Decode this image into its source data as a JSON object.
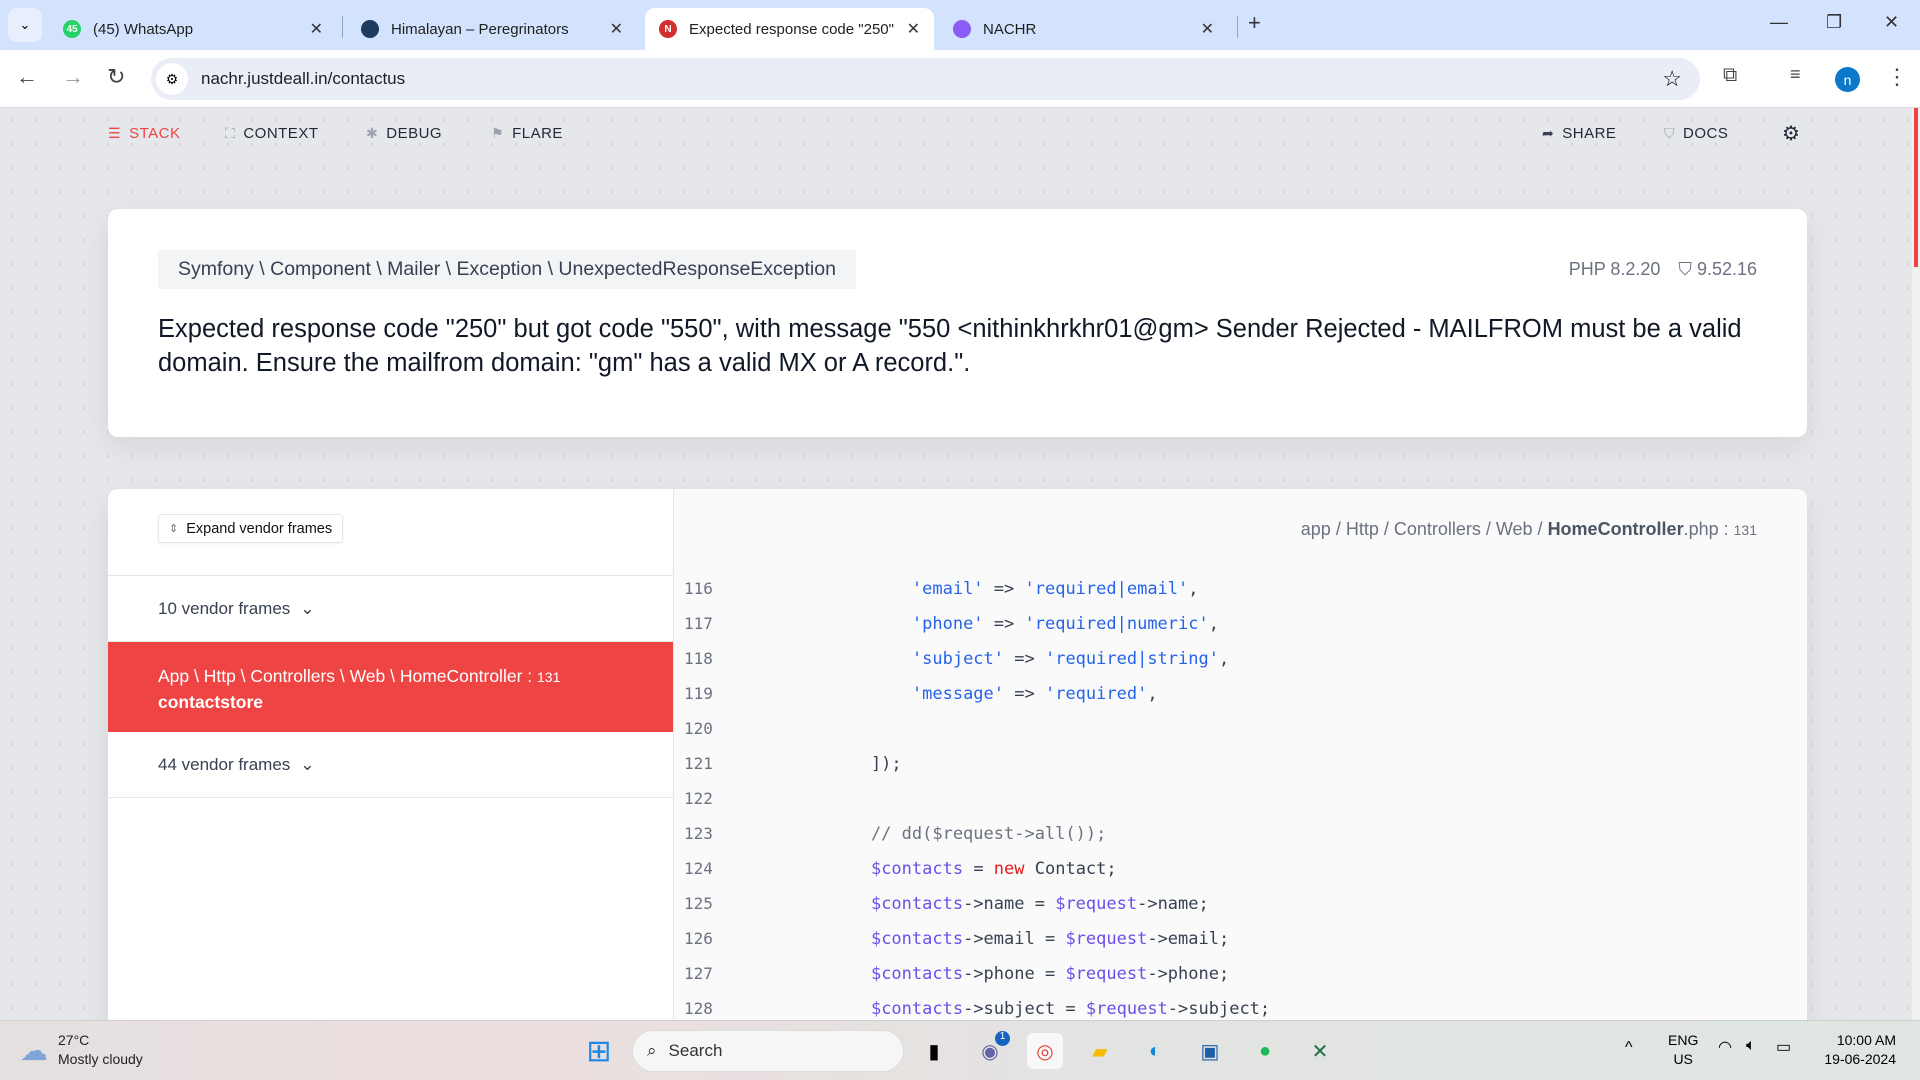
{
  "browser": {
    "tabs": [
      {
        "title": "(45) WhatsApp",
        "badge": "45",
        "color": "#25d366"
      },
      {
        "title": "Himalayan – Peregrinators",
        "color": "#1e3a5f"
      },
      {
        "title": "Expected response code \"250\" but got code \"550\"",
        "icon_letter": "N",
        "color": "#d32f2f",
        "active": true
      },
      {
        "title": "NACHR",
        "color": "#8b5cf6"
      }
    ],
    "url": "nachr.justdeall.in/contactus",
    "profile_initial": "n"
  },
  "nav": {
    "stack": "STACK",
    "context": "CONTEXT",
    "debug": "DEBUG",
    "flare": "FLARE",
    "share": "SHARE",
    "docs": "DOCS"
  },
  "exception": {
    "class": "Symfony \\ Component \\ Mailer \\ Exception \\ UnexpectedResponseException",
    "php_version": "PHP 8.2.20",
    "laravel_version": "9.52.16",
    "message": "Expected response code \"250\" but got code \"550\", with message \"550 <nithinkhrkhr01@gm> Sender Rejected - MAILFROM must be a valid domain. Ensure the mailfrom domain: \"gm\" has a valid MX or A record.\"."
  },
  "trace": {
    "expand_label": "Expand vendor frames",
    "vendor_frames_top": "10 vendor frames",
    "vendor_frames_bottom": "44 vendor frames",
    "active_frame": {
      "class": "App \\ Http \\ Controllers \\ Web \\ HomeController",
      "line": "131",
      "method": "contactstore"
    },
    "file_path": {
      "dirs": "app / Http / Controllers / Web / ",
      "file": "HomeController",
      "ext": ".php",
      "sep": " : ",
      "line": "131"
    },
    "code": [
      {
        "n": "116",
        "tokens": [
          [
            "p",
            "        "
          ],
          [
            "str",
            "'email'"
          ],
          [
            "p",
            " => "
          ],
          [
            "str",
            "'required|email'"
          ],
          [
            "p",
            ","
          ]
        ]
      },
      {
        "n": "117",
        "tokens": [
          [
            "p",
            "        "
          ],
          [
            "str",
            "'phone'"
          ],
          [
            "p",
            " => "
          ],
          [
            "str",
            "'required|numeric'"
          ],
          [
            "p",
            ","
          ]
        ]
      },
      {
        "n": "118",
        "tokens": [
          [
            "p",
            "        "
          ],
          [
            "str",
            "'subject'"
          ],
          [
            "p",
            " => "
          ],
          [
            "str",
            "'required|string'"
          ],
          [
            "p",
            ","
          ]
        ]
      },
      {
        "n": "119",
        "tokens": [
          [
            "p",
            "        "
          ],
          [
            "str",
            "'message'"
          ],
          [
            "p",
            " => "
          ],
          [
            "str",
            "'required'"
          ],
          [
            "p",
            ","
          ]
        ]
      },
      {
        "n": "120",
        "tokens": []
      },
      {
        "n": "121",
        "tokens": [
          [
            "p",
            "    ]);"
          ]
        ]
      },
      {
        "n": "122",
        "tokens": []
      },
      {
        "n": "123",
        "tokens": [
          [
            "cm",
            "    // dd($request->all());"
          ]
        ]
      },
      {
        "n": "124",
        "tokens": [
          [
            "p",
            "    "
          ],
          [
            "var",
            "$contacts"
          ],
          [
            "p",
            " = "
          ],
          [
            "kw",
            "new"
          ],
          [
            "p",
            " Contact;"
          ]
        ]
      },
      {
        "n": "125",
        "tokens": [
          [
            "p",
            "    "
          ],
          [
            "var",
            "$contacts"
          ],
          [
            "p",
            "->name = "
          ],
          [
            "var",
            "$request"
          ],
          [
            "p",
            "->name;"
          ]
        ]
      },
      {
        "n": "126",
        "tokens": [
          [
            "p",
            "    "
          ],
          [
            "var",
            "$contacts"
          ],
          [
            "p",
            "->email = "
          ],
          [
            "var",
            "$request"
          ],
          [
            "p",
            "->email;"
          ]
        ]
      },
      {
        "n": "127",
        "tokens": [
          [
            "p",
            "    "
          ],
          [
            "var",
            "$contacts"
          ],
          [
            "p",
            "->phone = "
          ],
          [
            "var",
            "$request"
          ],
          [
            "p",
            "->phone;"
          ]
        ]
      },
      {
        "n": "128",
        "tokens": [
          [
            "p",
            "    "
          ],
          [
            "var",
            "$contacts"
          ],
          [
            "p",
            "->subject = "
          ],
          [
            "var",
            "$request"
          ],
          [
            "p",
            "->subject;"
          ]
        ]
      }
    ]
  },
  "taskbar": {
    "weather_temp": "27°C",
    "weather_desc": "Mostly cloudy",
    "search_placeholder": "Search",
    "teams_badge": "1",
    "lang": "ENG",
    "region": "US",
    "time": "10:00 AM",
    "date": "19-06-2024"
  }
}
